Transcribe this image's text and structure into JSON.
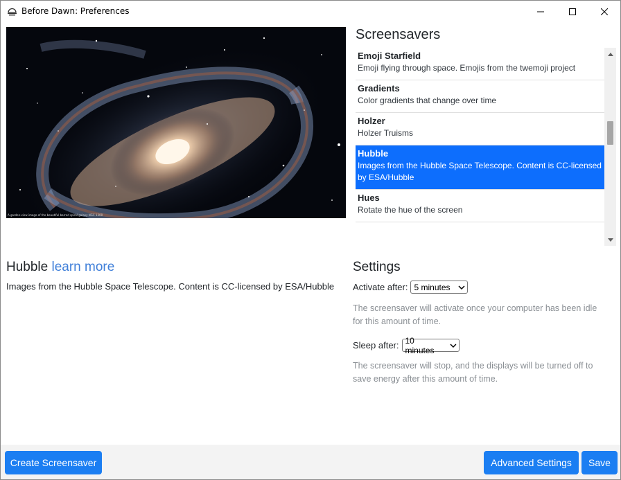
{
  "window": {
    "title": "Before Dawn: Preferences"
  },
  "preview": {
    "caption": "A garden-view image of the beautiful barred spiral galaxy NGC 1300"
  },
  "screensavers": {
    "heading": "Screensavers",
    "items": [
      {
        "name": "Emoji Starfield",
        "description": "Emoji flying through space. Emojis from the twemoji project",
        "selected": false
      },
      {
        "name": "Gradients",
        "description": "Color gradients that change over time",
        "selected": false
      },
      {
        "name": "Holzer",
        "description": "Holzer Truisms",
        "selected": false
      },
      {
        "name": "Hubble",
        "description": "Images from the Hubble Space Telescope. Content is CC-licensed by ESA/Hubble",
        "selected": true
      },
      {
        "name": "Hues",
        "description": "Rotate the hue of the screen",
        "selected": false
      }
    ]
  },
  "details": {
    "title": "Hubble",
    "learn_more": "learn more",
    "description": "Images from the Hubble Space Telescope. Content is CC-licensed by ESA/Hubble"
  },
  "settings": {
    "heading": "Settings",
    "activate_label": "Activate after:",
    "activate_value": "5 minutes",
    "activate_help": "The screensaver will activate once your computer has been idle for this amount of time.",
    "sleep_label": "Sleep after:",
    "sleep_value": "10 minutes",
    "sleep_help": "The screensaver will stop, and the displays will be turned off to save energy after this amount of time."
  },
  "footer": {
    "create_label": "Create Screensaver",
    "advanced_label": "Advanced Settings",
    "save_label": "Save"
  },
  "colors": {
    "accent": "#1b7ef2",
    "selected_item": "#0d6efd",
    "link": "#3f7fd9",
    "help_text": "#8a8f94",
    "footer_bg": "#f3f3f3"
  },
  "icons": {
    "app": "before-dawn-icon",
    "minimize": "minimize-icon",
    "maximize": "maximize-icon",
    "close": "close-icon",
    "scroll_up": "chevron-up-icon",
    "scroll_down": "chevron-down-icon",
    "dropdown": "chevron-down-icon"
  }
}
